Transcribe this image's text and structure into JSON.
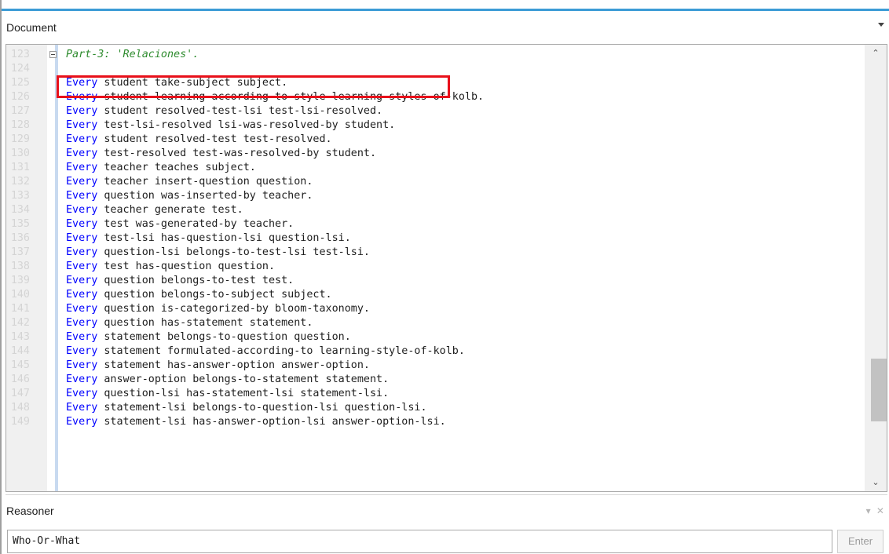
{
  "document_panel": {
    "title": "Document"
  },
  "editor": {
    "lines": [
      {
        "num": "123",
        "keyword": "",
        "text": "Part-3: 'Relaciones'.",
        "comment": true,
        "fold": true
      },
      {
        "num": "124",
        "keyword": "",
        "text": "",
        "comment": false,
        "fold": false
      },
      {
        "num": "125",
        "keyword": "Every",
        "text": " student take-subject subject.",
        "comment": false,
        "fold": false
      },
      {
        "num": "126",
        "keyword": "Every",
        "text": " student learning-according-to-style learning-styles-of-kolb.",
        "comment": false,
        "fold": false
      },
      {
        "num": "127",
        "keyword": "Every",
        "text": " student resolved-test-lsi test-lsi-resolved.",
        "comment": false,
        "fold": false
      },
      {
        "num": "128",
        "keyword": "Every",
        "text": " test-lsi-resolved lsi-was-resolved-by student.",
        "comment": false,
        "fold": false
      },
      {
        "num": "129",
        "keyword": "Every",
        "text": " student resolved-test test-resolved.",
        "comment": false,
        "fold": false
      },
      {
        "num": "130",
        "keyword": "Every",
        "text": " test-resolved test-was-resolved-by student.",
        "comment": false,
        "fold": false
      },
      {
        "num": "131",
        "keyword": "Every",
        "text": " teacher teaches subject.",
        "comment": false,
        "fold": false
      },
      {
        "num": "132",
        "keyword": "Every",
        "text": " teacher insert-question question.",
        "comment": false,
        "fold": false
      },
      {
        "num": "133",
        "keyword": "Every",
        "text": " question was-inserted-by teacher.",
        "comment": false,
        "fold": false
      },
      {
        "num": "134",
        "keyword": "Every",
        "text": " teacher generate test.",
        "comment": false,
        "fold": false
      },
      {
        "num": "135",
        "keyword": "Every",
        "text": " test was-generated-by teacher.",
        "comment": false,
        "fold": false
      },
      {
        "num": "136",
        "keyword": "Every",
        "text": " test-lsi has-question-lsi question-lsi.",
        "comment": false,
        "fold": false
      },
      {
        "num": "137",
        "keyword": "Every",
        "text": " question-lsi belongs-to-test-lsi test-lsi.",
        "comment": false,
        "fold": false
      },
      {
        "num": "138",
        "keyword": "Every",
        "text": " test has-question question.",
        "comment": false,
        "fold": false
      },
      {
        "num": "139",
        "keyword": "Every",
        "text": " question belongs-to-test test.",
        "comment": false,
        "fold": false
      },
      {
        "num": "140",
        "keyword": "Every",
        "text": " question belongs-to-subject subject.",
        "comment": false,
        "fold": false
      },
      {
        "num": "141",
        "keyword": "Every",
        "text": " question is-categorized-by bloom-taxonomy.",
        "comment": false,
        "fold": false
      },
      {
        "num": "142",
        "keyword": "Every",
        "text": " question has-statement statement.",
        "comment": false,
        "fold": false
      },
      {
        "num": "143",
        "keyword": "Every",
        "text": " statement belongs-to-question question.",
        "comment": false,
        "fold": false
      },
      {
        "num": "144",
        "keyword": "Every",
        "text": " statement formulated-according-to learning-style-of-kolb.",
        "comment": false,
        "fold": false
      },
      {
        "num": "145",
        "keyword": "Every",
        "text": " statement has-answer-option answer-option.",
        "comment": false,
        "fold": false
      },
      {
        "num": "146",
        "keyword": "Every",
        "text": " answer-option belongs-to-statement statement.",
        "comment": false,
        "fold": false
      },
      {
        "num": "147",
        "keyword": "Every",
        "text": " question-lsi has-statement-lsi statement-lsi.",
        "comment": false,
        "fold": false
      },
      {
        "num": "148",
        "keyword": "Every",
        "text": " statement-lsi belongs-to-question-lsi question-lsi.",
        "comment": false,
        "fold": false
      },
      {
        "num": "149",
        "keyword": "Every",
        "text": " statement-lsi has-answer-option-lsi answer-option-lsi.",
        "comment": false,
        "fold": false
      }
    ],
    "scroll_up_icon": "chevron-up-icon",
    "scroll_down_icon": "chevron-down-icon"
  },
  "reasoner_panel": {
    "title": "Reasoner",
    "query_value": "Who-Or-What",
    "enter_label": "Enter"
  },
  "colors": {
    "accent_bar": "#3c9cd6",
    "keyword": "#0000ff",
    "comment": "#2e8b2e",
    "highlight": "#e8101a"
  }
}
